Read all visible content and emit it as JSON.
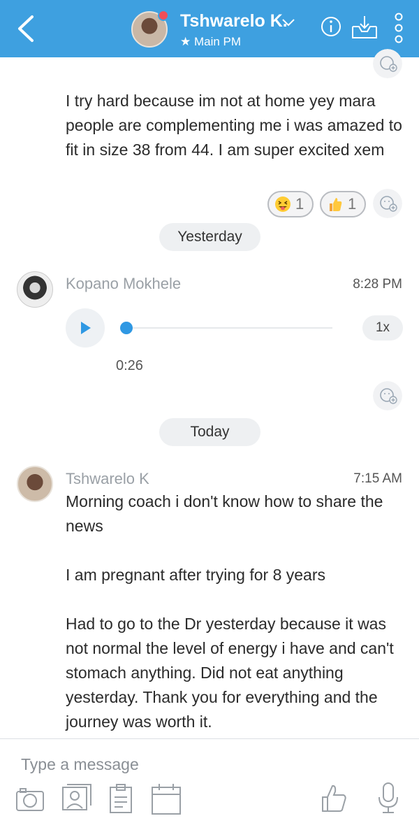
{
  "header": {
    "title": "Tshwarelo K.",
    "subtitle": "★ Main PM"
  },
  "messages": {
    "first": {
      "text": "I try hard because im not at home yey mara people are complementing me i was amazed to fit in size 38 from 44. I am super excited xem",
      "reactions": [
        {
          "emoji": "squinting-tongue-face",
          "count": "1"
        },
        {
          "emoji": "thumbs-up",
          "count": "1"
        }
      ]
    },
    "separator_yesterday": "Yesterday",
    "audio": {
      "sender": "Kopano Mokhele",
      "time": "8:28 PM",
      "speed": "1x",
      "duration": "0:26"
    },
    "separator_today": "Today",
    "last": {
      "sender": "Tshwarelo K",
      "time": "7:15 AM",
      "para1": "Morning coach i don't know how to share the news",
      "para2": "I am pregnant after trying for 8 years",
      "para3": "Had to go to the Dr yesterday because it was not normal the level of energy i have and can't stomach anything. Did not eat anything yesterday. Thank you for everything and the journey was worth it."
    }
  },
  "composer": {
    "placeholder": "Type a message"
  },
  "colors": {
    "header": "#3ea0e0",
    "accent": "#2f98e3",
    "online": "#f04e57"
  }
}
